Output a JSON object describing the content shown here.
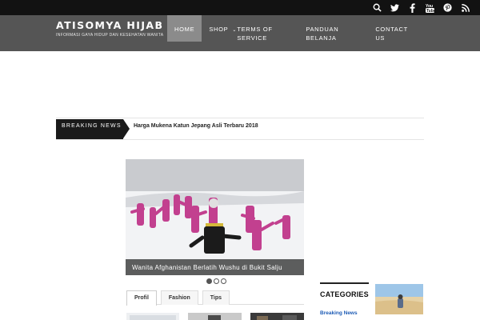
{
  "site": {
    "title": "ATISOMYA HIJAB",
    "tagline": "INFORMASI GAYA HIDUP DAN KESEHATAN WANITA"
  },
  "social_icons": [
    "search-icon",
    "twitter-icon",
    "facebook-icon",
    "youtube-icon",
    "pinterest-icon",
    "rss-icon"
  ],
  "nav": {
    "items": [
      {
        "label": "HOME",
        "active": true
      },
      {
        "label": "SHOP",
        "has_dropdown": true
      },
      {
        "label": "TERMS OF SERVICE"
      },
      {
        "label": "PANDUAN BELANJA"
      },
      {
        "label": "CONTACT US"
      }
    ]
  },
  "ticker": {
    "label": "BREAKING NEWS",
    "headline": "Harga Mukena Katun Jepang Asli Terbaru 2018"
  },
  "slider": {
    "caption": "Wanita Afghanistan Berlatih Wushu di Bukit Salju",
    "slide_count": 3,
    "active_slide": 1
  },
  "tabs": {
    "items": [
      "Profil",
      "Fashion",
      "Tips"
    ],
    "active": "Profil"
  },
  "sidebar": {
    "categories_title": "CATEGORIES",
    "first_category": "Breaking News"
  },
  "colors": {
    "topbar": "#121212",
    "header": "#555555",
    "nav_active": "#8b8b8b",
    "slide_outfit": "#c2408f",
    "category_link": "#1d5bb5"
  }
}
